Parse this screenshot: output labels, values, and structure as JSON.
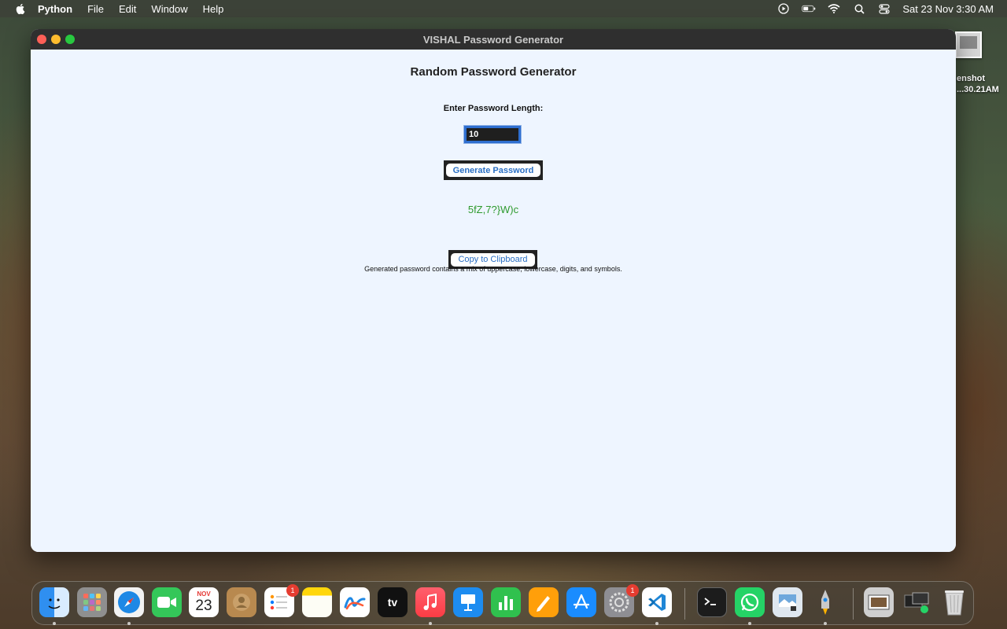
{
  "menubar": {
    "app_name": "Python",
    "items": [
      "File",
      "Edit",
      "Window",
      "Help"
    ],
    "datetime": "Sat 23 Nov  3:30 AM"
  },
  "desktop_file": {
    "name_line1": "enshot",
    "name_line2": "...30.21AM"
  },
  "window": {
    "title": "VISHAL Password Generator"
  },
  "app": {
    "heading": "Random Password Generator",
    "length_label": "Enter Password Length:",
    "length_value": "10",
    "generate_label": "Generate Password",
    "password": "5fZ,7?}W)c",
    "copy_label": "Copy to Clipboard",
    "note": "Generated password contains a mix of uppercase, lowercase, digits, and symbols.",
    "password_color": "#2e9a2e",
    "button_text_color": "#2a6fc4"
  },
  "dock": {
    "calendar_month": "NOV",
    "calendar_day": "23",
    "reminders_badge": "1",
    "settings_badge": "1",
    "tv_label": "tv"
  }
}
